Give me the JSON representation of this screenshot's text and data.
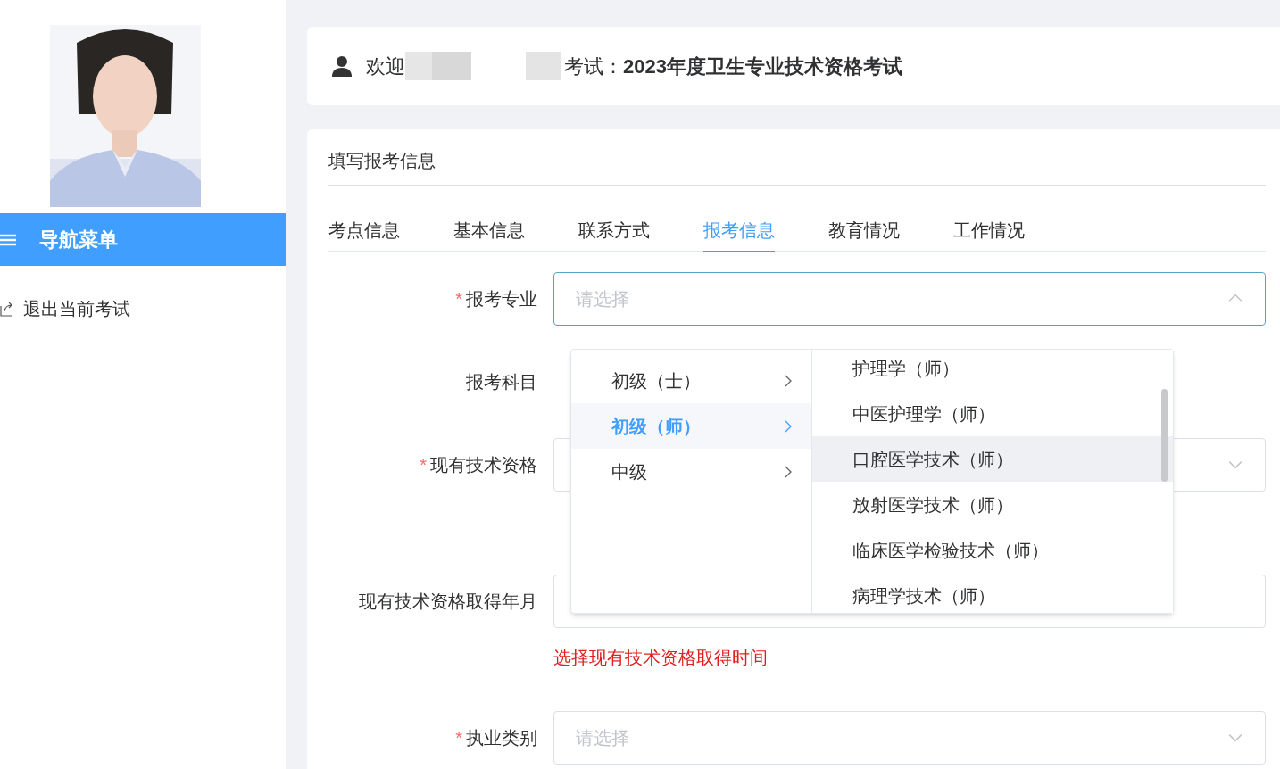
{
  "sidebar": {
    "nav_title": "导航菜单",
    "items": [
      {
        "label": "退出当前考试"
      }
    ]
  },
  "header": {
    "welcome_start": "欢迎",
    "welcome_end": "考试：",
    "exam_name": "2023年度卫生专业技术资格考试"
  },
  "form": {
    "title": "填写报考信息",
    "tabs": [
      {
        "label": "考点信息",
        "selected": false
      },
      {
        "label": "基本信息",
        "selected": false
      },
      {
        "label": "联系方式",
        "selected": false
      },
      {
        "label": "报考信息",
        "selected": true
      },
      {
        "label": "教育情况",
        "selected": false
      },
      {
        "label": "工作情况",
        "selected": false
      }
    ],
    "fields": [
      {
        "kind": "select",
        "label": "报考专业",
        "required_mark": "*",
        "placeholder": "请选择",
        "open": true
      },
      {
        "kind": "hidden",
        "label": "报考科目"
      },
      {
        "kind": "select",
        "label": "现有技术资格",
        "required_mark": "*",
        "open": false
      },
      {
        "kind": "date",
        "label": "现有技术资格取得年月",
        "error": "选择现有技术资格取得时间"
      },
      {
        "kind": "select",
        "label": "执业类别",
        "required_mark": "*",
        "placeholder": "请选择",
        "open": false
      }
    ]
  },
  "dropdown": {
    "levels": [
      {
        "label": "初级（士）",
        "selected": false
      },
      {
        "label": "初级（师）",
        "selected": true
      },
      {
        "label": "中级",
        "selected": false
      }
    ],
    "options": [
      {
        "label": "护理学（师）",
        "hovered": false
      },
      {
        "label": "中医护理学（师）",
        "hovered": false
      },
      {
        "label": "口腔医学技术（师）",
        "hovered": true
      },
      {
        "label": "放射医学技术（师）",
        "hovered": false
      },
      {
        "label": "临床医学检验技术（师）",
        "hovered": false
      },
      {
        "label": "病理学技术（师）",
        "hovered": false
      }
    ]
  }
}
